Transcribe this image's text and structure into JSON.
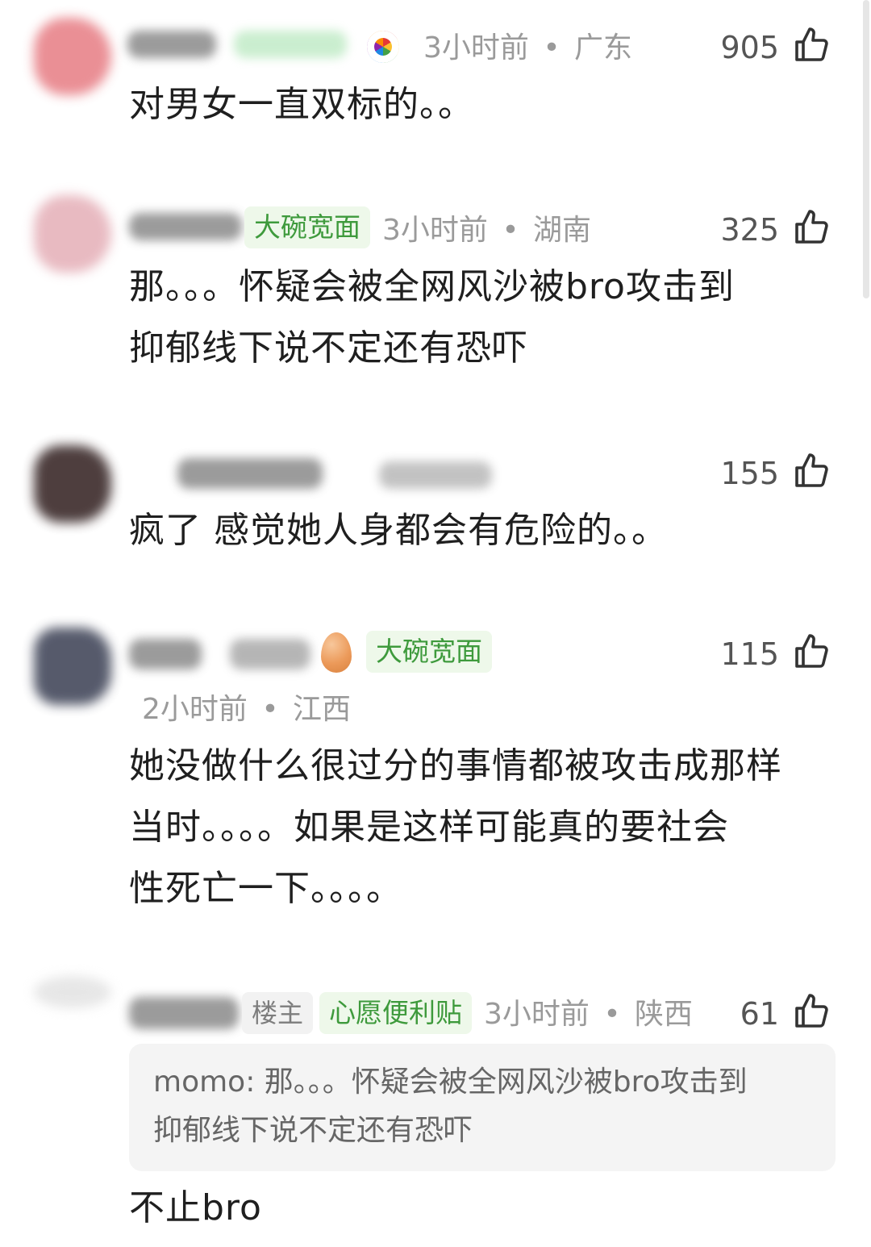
{
  "comments": [
    {
      "avatar_color": "#e8838a",
      "time": "3小时前",
      "location": "广东",
      "likes": "905",
      "text": "对男女一直双标的。。",
      "icon": "colorful-round-emoji-icon"
    },
    {
      "avatar_color": "#d79aa5",
      "badge": "大碗宽面",
      "time": "3小时前",
      "location": "湖南",
      "likes": "325",
      "text_lines": [
        "那。。。怀疑会被全网风沙被bro攻击到",
        "抑郁线下说不定还有恐吓"
      ]
    },
    {
      "avatar_color": "#3b2a2a",
      "likes": "155",
      "text": "疯了 感觉她人身都会有危险的。。"
    },
    {
      "avatar_color": "#44495c",
      "badge": "大碗宽面",
      "time": "2小时前",
      "location": "江西",
      "likes": "115",
      "icon": "egg-icon",
      "text_lines": [
        "她没做什么很过分的事情都被攻击成那样",
        "当时。。。。如果是这样可能真的要社会",
        "性死亡一下。。。。"
      ]
    },
    {
      "avatar_color": "#cfcfcf",
      "owner_badge": "楼主",
      "badge": "心愿便利贴",
      "time": "3小时前",
      "location": "陕西",
      "likes": "61",
      "quote_lines": [
        "momo: 那。。。怀疑会被全网风沙被bro攻击到",
        "抑郁线下说不定还有恐吓"
      ],
      "text": "不止bro"
    }
  ],
  "separator": "•",
  "colors": {
    "badge_green_bg": "#eef8ea",
    "badge_green_text": "#3e9a3c",
    "meta_gray": "#9a9a9a",
    "quote_bg": "#f4f4f4"
  }
}
